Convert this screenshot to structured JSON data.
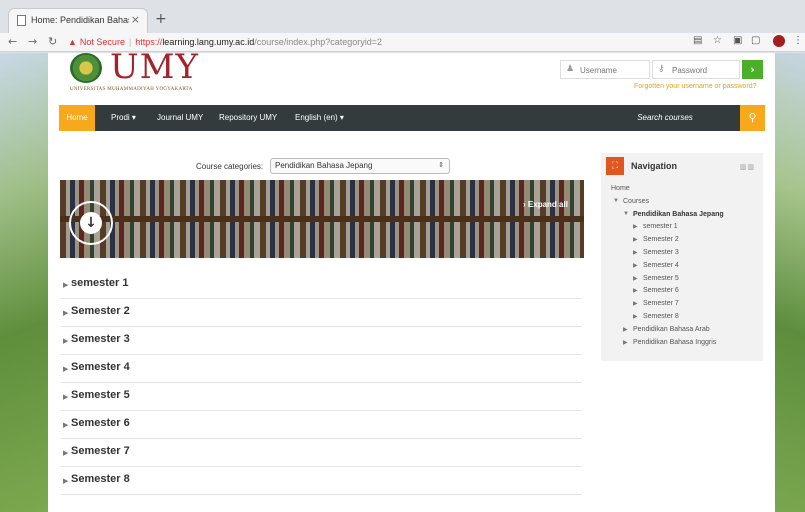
{
  "browser": {
    "tab_title": "Home: Pendidikan Bahasa Jep...",
    "tab_close": "×",
    "new_tab": "+",
    "not_secure": "Not Secure",
    "url_scheme": "https://",
    "url_host": "learning.lang.umy.ac.id",
    "url_path": "/course/index.php?categoryid=2"
  },
  "header": {
    "logo_text": "UMY",
    "logo_sub": "UNIVERSITAS MUHAMMADIYAH YOGYAKARTA",
    "username_placeholder": "Username",
    "password_placeholder": "Password",
    "login_button": "›",
    "forgot_link": "Forgotten your username or password?"
  },
  "navbar": {
    "items": [
      {
        "label": "Home"
      },
      {
        "label": "Prodi ▾"
      },
      {
        "label": "Journal UMY"
      },
      {
        "label": "Repository UMY"
      },
      {
        "label": "English (en) ▾"
      }
    ],
    "search_label": "Search courses",
    "search_icon": "search-icon"
  },
  "categories": {
    "label": "Course categories:",
    "selected": "Pendidikan Bahasa Jepang",
    "arrows": "⇕"
  },
  "banner": {
    "expand_all": "Expand all",
    "expand_prefix": "›"
  },
  "semesters": [
    {
      "label": "semester 1"
    },
    {
      "label": "Semester 2"
    },
    {
      "label": "Semester 3"
    },
    {
      "label": "Semester 4"
    },
    {
      "label": "Semester 5"
    },
    {
      "label": "Semester 6"
    },
    {
      "label": "Semester 7"
    },
    {
      "label": "Semester 8"
    }
  ],
  "navigation": {
    "title": "Navigation",
    "tree": [
      {
        "label": "Home",
        "marker": ""
      },
      {
        "label": "Courses",
        "marker": "▼"
      },
      {
        "label": "Pendidikan Bahasa Jepang",
        "marker": "▼"
      },
      {
        "label": "semester 1",
        "marker": "▶"
      },
      {
        "label": "Semester 2",
        "marker": "▶"
      },
      {
        "label": "Semester 3",
        "marker": "▶"
      },
      {
        "label": "Semester 4",
        "marker": "▶"
      },
      {
        "label": "Semester 5",
        "marker": "▶"
      },
      {
        "label": "Semester 6",
        "marker": "▶"
      },
      {
        "label": "Semester 7",
        "marker": "▶"
      },
      {
        "label": "Semester 8",
        "marker": "▶"
      },
      {
        "label": "Pendidikan Bahasa Arab",
        "marker": "▶"
      },
      {
        "label": "Pendidikan Bahasa Inggris",
        "marker": "▶"
      }
    ]
  },
  "colors": {
    "accent": "#f7a81b",
    "navbar_bg": "#333b3d",
    "brand_red": "#a3232a",
    "login_green": "#4caf29",
    "nav_icon": "#e1561f"
  }
}
